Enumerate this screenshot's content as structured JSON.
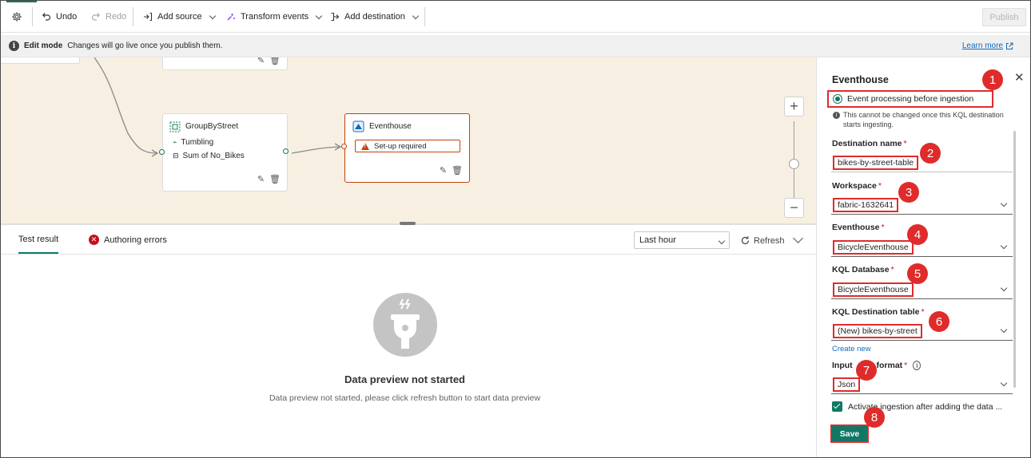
{
  "toolbar": {
    "undo_label": "Undo",
    "redo_label": "Redo",
    "add_source_label": "Add source",
    "transform_events_label": "Transform events",
    "add_destination_label": "Add destination",
    "publish_label": "Publish",
    "icons": [
      "gear-icon",
      "undo-icon",
      "redo-icon",
      "add-source-icon",
      "transform-icon",
      "add-destination-icon"
    ]
  },
  "mode_bar": {
    "title": "Edit mode",
    "message": "Changes will go live once you publish them.",
    "learn_more": "Learn more"
  },
  "canvas": {
    "group_node": {
      "title": "GroupByStreet",
      "window_type": "Tumbling",
      "aggregation": "Sum of No_Bikes"
    },
    "eventhouse_node": {
      "title": "Eventhouse",
      "status": "Set-up required"
    }
  },
  "results": {
    "tabs": [
      {
        "label": "Test result",
        "active": true
      },
      {
        "label": "Authoring errors",
        "active": false
      }
    ],
    "time_range": "Last hour",
    "refresh_label": "Refresh",
    "empty_title": "Data preview not started",
    "empty_message": "Data preview not started, please click refresh button to start data preview"
  },
  "panel": {
    "title": "Eventhouse",
    "mode_option": "Event processing before ingestion",
    "mode_note": "This cannot be changed once this KQL destination starts ingesting.",
    "fields": {
      "destination_name": {
        "label": "Destination name",
        "value": "bikes-by-street-table"
      },
      "workspace": {
        "label": "Workspace",
        "value": "fabric-1632641"
      },
      "eventhouse": {
        "label": "Eventhouse",
        "value": "BicycleEventhouse"
      },
      "kql_database": {
        "label": "KQL Database",
        "value": "BicycleEventhouse"
      },
      "kql_table": {
        "label": "KQL Destination table",
        "value": "(New) bikes-by-street"
      },
      "input_format": {
        "label_prefix": "Input",
        "label_suffix": "format",
        "value": "Json"
      }
    },
    "required_marker": "*",
    "create_new": "Create new",
    "activate_label": "Activate ingestion after adding the data ...",
    "activate_checked": true,
    "save_label": "Save"
  },
  "callouts": [
    "1",
    "2",
    "3",
    "4",
    "5",
    "6",
    "7",
    "8"
  ],
  "colors": {
    "accent": "#117865",
    "callout": "#e02b2b",
    "warning": "#c2410c",
    "canvas_bg": "#f7f0e2",
    "link": "#0f6cbd"
  }
}
